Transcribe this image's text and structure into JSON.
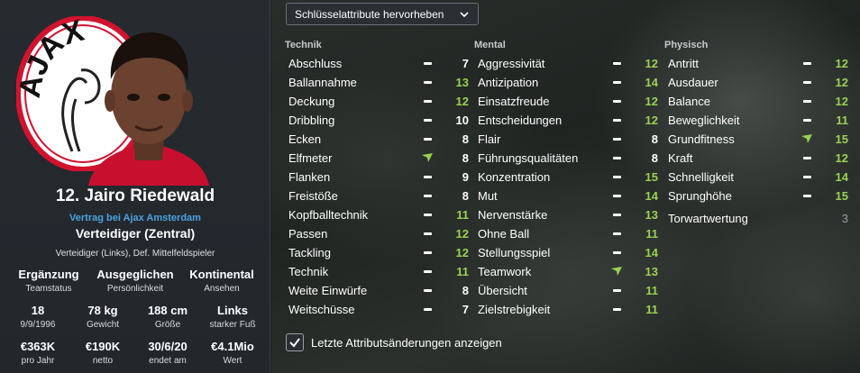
{
  "player": {
    "name": "12. Jairo Riedewald",
    "contract": "Vertrag bei Ajax Amsterdam",
    "position": "Verteidiger (Zentral)",
    "positions_detail": "Verteidiger (Links), Def. Mittelfeldspieler",
    "club_logo_text": "AJAX",
    "info_row1": [
      {
        "value": "Ergänzung",
        "label": "Teamstatus"
      },
      {
        "value": "Ausgeglichen",
        "label": "Persönlichkeit"
      },
      {
        "value": "Kontinental",
        "label": "Ansehen"
      }
    ],
    "info_row2": [
      {
        "value": "18",
        "label": "9/9/1996"
      },
      {
        "value": "78 kg",
        "label": "Gewicht"
      },
      {
        "value": "188 cm",
        "label": "Größe"
      },
      {
        "value": "Links",
        "label": "starker Fuß"
      }
    ],
    "info_row3": [
      {
        "value": "€363K",
        "label": "pro Jahr"
      },
      {
        "value": "€190K",
        "label": "netto"
      },
      {
        "value": "30/6/20",
        "label": "endet am"
      },
      {
        "value": "€4.1Mio",
        "label": "Wert"
      }
    ]
  },
  "dropdown": {
    "label": "Schlüsselattribute hervorheben",
    "icon": "chevron-down-icon"
  },
  "columns": [
    {
      "heading": "Technik",
      "attributes": [
        {
          "name": "Abschluss",
          "value": "7",
          "trend": "dash",
          "color": "white"
        },
        {
          "name": "Ballannahme",
          "value": "13",
          "trend": "dash",
          "color": "green"
        },
        {
          "name": "Deckung",
          "value": "12",
          "trend": "dash",
          "color": "green"
        },
        {
          "name": "Dribbling",
          "value": "10",
          "trend": "dash",
          "color": "white"
        },
        {
          "name": "Ecken",
          "value": "8",
          "trend": "dash",
          "color": "white"
        },
        {
          "name": "Elfmeter",
          "value": "8",
          "trend": "up",
          "color": "white"
        },
        {
          "name": "Flanken",
          "value": "9",
          "trend": "dash",
          "color": "white"
        },
        {
          "name": "Freistöße",
          "value": "8",
          "trend": "dash",
          "color": "white"
        },
        {
          "name": "Kopfballtechnik",
          "value": "11",
          "trend": "dash",
          "color": "green"
        },
        {
          "name": "Passen",
          "value": "12",
          "trend": "dash",
          "color": "green"
        },
        {
          "name": "Tackling",
          "value": "12",
          "trend": "dash",
          "color": "green"
        },
        {
          "name": "Technik",
          "value": "11",
          "trend": "dash",
          "color": "green"
        },
        {
          "name": "Weite Einwürfe",
          "value": "8",
          "trend": "dash",
          "color": "white"
        },
        {
          "name": "Weitschüsse",
          "value": "7",
          "trend": "dash",
          "color": "white"
        }
      ]
    },
    {
      "heading": "Mental",
      "attributes": [
        {
          "name": "Aggressivität",
          "value": "12",
          "trend": "dash",
          "color": "green"
        },
        {
          "name": "Antizipation",
          "value": "14",
          "trend": "dash",
          "color": "green"
        },
        {
          "name": "Einsatzfreude",
          "value": "12",
          "trend": "dash",
          "color": "green"
        },
        {
          "name": "Entscheidungen",
          "value": "12",
          "trend": "dash",
          "color": "green"
        },
        {
          "name": "Flair",
          "value": "8",
          "trend": "dash",
          "color": "white"
        },
        {
          "name": "Führungsqualitäten",
          "value": "8",
          "trend": "dash",
          "color": "white"
        },
        {
          "name": "Konzentration",
          "value": "15",
          "trend": "dash",
          "color": "green"
        },
        {
          "name": "Mut",
          "value": "14",
          "trend": "dash",
          "color": "green"
        },
        {
          "name": "Nervenstärke",
          "value": "13",
          "trend": "dash",
          "color": "green"
        },
        {
          "name": "Ohne Ball",
          "value": "11",
          "trend": "dash",
          "color": "green"
        },
        {
          "name": "Stellungsspiel",
          "value": "14",
          "trend": "dash",
          "color": "green"
        },
        {
          "name": "Teamwork",
          "value": "13",
          "trend": "up",
          "color": "green"
        },
        {
          "name": "Übersicht",
          "value": "11",
          "trend": "dash",
          "color": "green"
        },
        {
          "name": "Zielstrebigkeit",
          "value": "11",
          "trend": "dash",
          "color": "green"
        }
      ]
    },
    {
      "heading": "Physisch",
      "attributes": [
        {
          "name": "Antritt",
          "value": "12",
          "trend": "dash",
          "color": "green"
        },
        {
          "name": "Ausdauer",
          "value": "12",
          "trend": "dash",
          "color": "green"
        },
        {
          "name": "Balance",
          "value": "12",
          "trend": "dash",
          "color": "green"
        },
        {
          "name": "Beweglichkeit",
          "value": "11",
          "trend": "dash",
          "color": "green"
        },
        {
          "name": "Grundfitness",
          "value": "15",
          "trend": "up",
          "color": "green"
        },
        {
          "name": "Kraft",
          "value": "12",
          "trend": "dash",
          "color": "green"
        },
        {
          "name": "Schnelligkeit",
          "value": "14",
          "trend": "dash",
          "color": "green"
        },
        {
          "name": "Sprunghöhe",
          "value": "15",
          "trend": "dash",
          "color": "green"
        },
        {
          "name": "Torwartwertung",
          "value": "3",
          "trend": "none",
          "color": "dim"
        }
      ]
    }
  ],
  "checkbox": {
    "label": "Letzte Attributsänderungen anzeigen",
    "checked": true
  },
  "colors": {
    "green": "#9ad152",
    "white": "#ffffff",
    "dim": "#9aa0a4",
    "trend_up": "#9ad152",
    "link": "#4aa3e0",
    "ajax_red": "#d2122e"
  }
}
